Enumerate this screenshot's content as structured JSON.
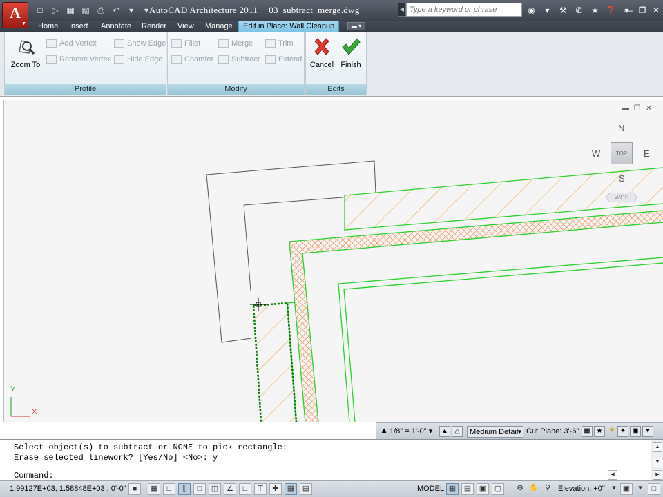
{
  "app": {
    "title": "AutoCAD Architecture 2011",
    "document": "03_subtract_merge.dwg",
    "app_button_letter": "A"
  },
  "search": {
    "placeholder": "Type a keyword or phrase"
  },
  "tabs": [
    {
      "label": "Home"
    },
    {
      "label": "Insert"
    },
    {
      "label": "Annotate"
    },
    {
      "label": "Render"
    },
    {
      "label": "View"
    },
    {
      "label": "Manage"
    },
    {
      "label": "Edit in Place: Wall Cleanup",
      "active": true
    }
  ],
  "ribbon": {
    "profile": {
      "label": "Profile",
      "zoom_to": "Zoom To",
      "add_vertex": "Add Vertex",
      "remove_vertex": "Remove Vertex",
      "show_edge": "Show Edge",
      "hide_edge": "Hide Edge"
    },
    "modify": {
      "label": "Modify",
      "fillet": "Fillet",
      "chamfer": "Chamfer",
      "merge": "Merge",
      "subtract": "Subtract",
      "trim": "Trim",
      "extend": "Extend"
    },
    "edits": {
      "label": "Edits",
      "cancel": "Cancel",
      "finish": "Finish"
    }
  },
  "viewcube": {
    "north": "N",
    "south": "S",
    "east": "E",
    "west": "W",
    "face": "TOP",
    "ucs_menu": "WCS"
  },
  "ucs_icon": {
    "x": "X",
    "y": "Y"
  },
  "annotation_bar": {
    "scale": "1/8\" = 1'-0\"",
    "detail": "Medium Detail",
    "cut_plane_label": "Cut Plane:",
    "cut_plane_value": "3'-6\""
  },
  "command": {
    "history": [
      "Select object(s) to subtract or NONE to pick rectangle:",
      "Erase selected linework? [Yes/No] <No>: y"
    ],
    "prompt": "Command:"
  },
  "status": {
    "coordinates": "1.99127E+03, 1.58848E+03 , 0'-0\"",
    "space": "MODEL",
    "elevation_label": "Elevation:",
    "elevation_value": "+0\""
  },
  "colors": {
    "wall_line": "#2bd12b",
    "hatch": "#f0c890",
    "viewport_bg": "#f5f5f5",
    "ribbon_label": "#9fcbdc"
  }
}
